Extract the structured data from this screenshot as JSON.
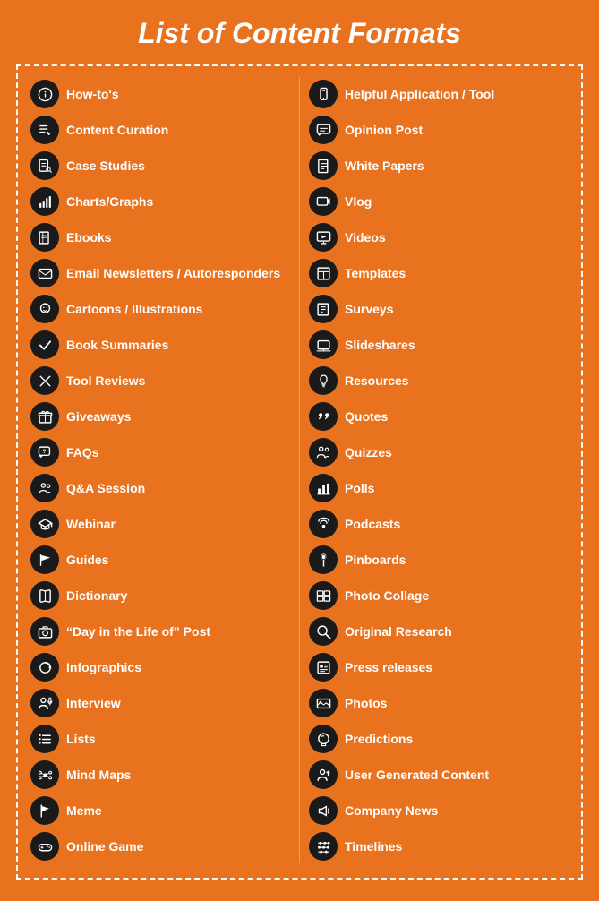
{
  "title": "List of Content Formats",
  "left_column": [
    {
      "label": "How-to's",
      "icon": "ℹ"
    },
    {
      "label": "Content Curation",
      "icon": "✏"
    },
    {
      "label": "Case Studies",
      "icon": "📋"
    },
    {
      "label": "Charts/Graphs",
      "icon": "📊"
    },
    {
      "label": "Ebooks",
      "icon": "📚"
    },
    {
      "label": "Email Newsletters / Autoresponders",
      "icon": "✉"
    },
    {
      "label": "Cartoons / Illustrations",
      "icon": "🎨"
    },
    {
      "label": "Book Summaries",
      "icon": "✔"
    },
    {
      "label": "Tool Reviews",
      "icon": "✂"
    },
    {
      "label": "Giveaways",
      "icon": "🎁"
    },
    {
      "label": "FAQs",
      "icon": "💬"
    },
    {
      "label": "Q&A Session",
      "icon": "👥"
    },
    {
      "label": "Webinar",
      "icon": "🎓"
    },
    {
      "label": "Guides",
      "icon": "📌"
    },
    {
      "label": "Dictionary",
      "icon": "📖"
    },
    {
      "label": "“Day in the Life of” Post",
      "icon": "📷"
    },
    {
      "label": "Infographics",
      "icon": "🔄"
    },
    {
      "label": "Interview",
      "icon": "👤"
    },
    {
      "label": "Lists",
      "icon": "📝"
    },
    {
      "label": "Mind Maps",
      "icon": "🧠"
    },
    {
      "label": "Meme",
      "icon": "🚩"
    },
    {
      "label": "Online Game",
      "icon": "🎮"
    }
  ],
  "right_column": [
    {
      "label": "Helpful Application / Tool",
      "icon": "📱"
    },
    {
      "label": "Opinion Post",
      "icon": "💬"
    },
    {
      "label": "White Papers",
      "icon": "📄"
    },
    {
      "label": "Vlog",
      "icon": "🎬"
    },
    {
      "label": "Videos",
      "icon": "🖥"
    },
    {
      "label": "Templates",
      "icon": "📋"
    },
    {
      "label": "Surveys",
      "icon": "📝"
    },
    {
      "label": "Slideshares",
      "icon": "📊"
    },
    {
      "label": "Resources",
      "icon": "💡"
    },
    {
      "label": "Quotes",
      "icon": "❝"
    },
    {
      "label": "Quizzes",
      "icon": "👥"
    },
    {
      "label": "Polls",
      "icon": "📊"
    },
    {
      "label": "Podcasts",
      "icon": "📡"
    },
    {
      "label": "Pinboards",
      "icon": "📌"
    },
    {
      "label": "Photo Collage",
      "icon": "🖼"
    },
    {
      "label": "Original Research",
      "icon": "🔍"
    },
    {
      "label": "Press releases",
      "icon": "📰"
    },
    {
      "label": "Photos",
      "icon": "🌄"
    },
    {
      "label": "Predictions",
      "icon": "🔮"
    },
    {
      "label": "User Generated Content",
      "icon": "👤"
    },
    {
      "label": "Company News",
      "icon": "📢"
    },
    {
      "label": "Timelines",
      "icon": "⚙"
    }
  ]
}
